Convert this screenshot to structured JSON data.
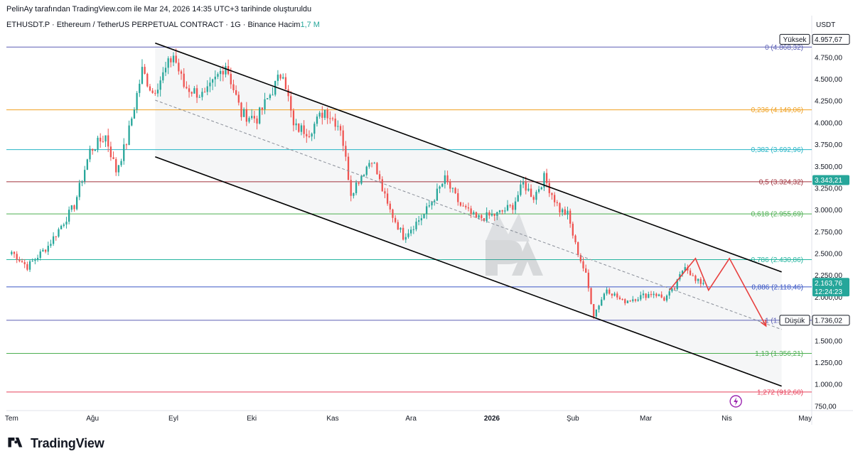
{
  "header": {
    "attribution": "PelinAy tarafından TradingView.com ile Mar 24, 2026 14:35 UTC+3 tarihinde oluşturuldu",
    "symbol": "ETHUSDT.P · Ethereum / TetherUS PERPETUAL CONTRACT · 1G · Binance",
    "volume_label": "Hacim",
    "volume_value": "1,7 M",
    "currency": "USDT"
  },
  "brand": {
    "name": "TradingView",
    "logo_icon": "tradingview-logo-icon"
  },
  "colors": {
    "up": "#26a69a",
    "down": "#ef5350",
    "channel": "#000000",
    "projection": "#e8403f",
    "text": "#131722"
  },
  "chart_data": {
    "type": "candlestick",
    "title": "",
    "ylim": [
      700,
      5050
    ],
    "y_ticks": [
      {
        "value": 4750,
        "label": "4.750,00"
      },
      {
        "value": 4500,
        "label": "4.500,00"
      },
      {
        "value": 4250,
        "label": "4.250,00"
      },
      {
        "value": 4000,
        "label": "4.000,00"
      },
      {
        "value": 3750,
        "label": "3.750,00"
      },
      {
        "value": 3500,
        "label": "3.500,00"
      },
      {
        "value": 3250,
        "label": "3.250,00"
      },
      {
        "value": 3000,
        "label": "3.000,00"
      },
      {
        "value": 2750,
        "label": "2.750,00"
      },
      {
        "value": 2500,
        "label": "2.500,00"
      },
      {
        "value": 2250,
        "label": "2.250,00"
      },
      {
        "value": 2000,
        "label": "2.000,00"
      },
      {
        "value": 1500,
        "label": "1.500,00"
      },
      {
        "value": 1250,
        "label": "1.250,00"
      },
      {
        "value": 1000,
        "label": "1.000,00"
      },
      {
        "value": 750,
        "label": "750,00"
      }
    ],
    "x_ticks": [
      {
        "day": 0,
        "label": "Tem"
      },
      {
        "day": 31,
        "label": "Ağu"
      },
      {
        "day": 62,
        "label": "Eyl"
      },
      {
        "day": 92,
        "label": "Eki"
      },
      {
        "day": 123,
        "label": "Kas"
      },
      {
        "day": 153,
        "label": "Ara"
      },
      {
        "day": 184,
        "label": "2026"
      },
      {
        "day": 215,
        "label": "Şub"
      },
      {
        "day": 243,
        "label": "Mar"
      },
      {
        "day": 274,
        "label": "Nis"
      },
      {
        "day": 304,
        "label": "May"
      }
    ],
    "x_range_days": [
      -2,
      306
    ],
    "fib_levels": [
      {
        "ratio": 0,
        "price": 4868.32,
        "label": "0 (4.868,32)",
        "color": "#5b5fb5"
      },
      {
        "ratio": 0.236,
        "price": 4149.06,
        "label": "0,236 (4.149,06)",
        "color": "#f0a020"
      },
      {
        "ratio": 0.382,
        "price": 3692.96,
        "label": "0,382 (3.692,96)",
        "color": "#26b5c6"
      },
      {
        "ratio": 0.5,
        "price": 3324.32,
        "label": "0,5 (3.324,32)",
        "color": "#a0323c"
      },
      {
        "ratio": 0.618,
        "price": 2955.69,
        "label": "0,618 (2.955,69)",
        "color": "#4caf50"
      },
      {
        "ratio": 0.786,
        "price": 2430.86,
        "label": "0,786 (2.430,86)",
        "color": "#26b5a0"
      },
      {
        "ratio": 0.886,
        "price": 2118.46,
        "label": "0,886 (2.118,46)",
        "color": "#3a56c5"
      },
      {
        "ratio": 1,
        "price": 1736.02,
        "label": "1 (1.736,02)",
        "color": "#5b5fb5"
      },
      {
        "ratio": 1.13,
        "price": 1356.21,
        "label": "1,13 (1.356,21)",
        "color": "#4caf50"
      },
      {
        "ratio": 1.272,
        "price": 912.6,
        "label": "1,272 (912,60)",
        "color": "#e8405a"
      }
    ],
    "price_tags": [
      {
        "price": 4957.67,
        "label": "4.957,67",
        "caption": "Yüksek",
        "style": "outline"
      },
      {
        "price": 3343.21,
        "label": "3.343,21",
        "caption": "",
        "style": "green"
      },
      {
        "price": 2163.76,
        "label": "2.163,76",
        "caption": "12:24:23",
        "style": "green"
      },
      {
        "price": 1736.02,
        "label": "1.736,02",
        "caption": "Düşük",
        "style": "outline"
      }
    ],
    "channel": {
      "upper": [
        [
          55,
          4915
        ],
        [
          295,
          2290
        ]
      ],
      "lower": [
        [
          55,
          3610
        ],
        [
          295,
          980
        ]
      ],
      "middle": [
        [
          55,
          4260
        ],
        [
          295,
          1630
        ]
      ]
    },
    "projection": [
      [
        252,
        2080
      ],
      [
        262,
        2445
      ],
      [
        267,
        2080
      ],
      [
        275,
        2445
      ],
      [
        289,
        1670
      ]
    ],
    "key_points": [
      {
        "day": 0,
        "price": 2520
      },
      {
        "day": 6,
        "price": 2350
      },
      {
        "day": 14,
        "price": 2590
      },
      {
        "day": 24,
        "price": 3050
      },
      {
        "day": 30,
        "price": 3680
      },
      {
        "day": 36,
        "price": 3850
      },
      {
        "day": 40,
        "price": 3450
      },
      {
        "day": 44,
        "price": 3780
      },
      {
        "day": 50,
        "price": 4600
      },
      {
        "day": 54,
        "price": 4350
      },
      {
        "day": 58,
        "price": 4550
      },
      {
        "day": 62,
        "price": 4780
      },
      {
        "day": 66,
        "price": 4420
      },
      {
        "day": 74,
        "price": 4300
      },
      {
        "day": 82,
        "price": 4680
      },
      {
        "day": 88,
        "price": 4100
      },
      {
        "day": 94,
        "price": 4050
      },
      {
        "day": 104,
        "price": 4600
      },
      {
        "day": 108,
        "price": 3950
      },
      {
        "day": 114,
        "price": 3900
      },
      {
        "day": 120,
        "price": 4150
      },
      {
        "day": 126,
        "price": 3950
      },
      {
        "day": 130,
        "price": 3200
      },
      {
        "day": 138,
        "price": 3600
      },
      {
        "day": 144,
        "price": 3050
      },
      {
        "day": 150,
        "price": 2700
      },
      {
        "day": 158,
        "price": 2950
      },
      {
        "day": 166,
        "price": 3350
      },
      {
        "day": 172,
        "price": 3050
      },
      {
        "day": 178,
        "price": 2900
      },
      {
        "day": 186,
        "price": 2950
      },
      {
        "day": 192,
        "price": 3050
      },
      {
        "day": 196,
        "price": 3300
      },
      {
        "day": 200,
        "price": 3150
      },
      {
        "day": 204,
        "price": 3370
      },
      {
        "day": 210,
        "price": 3000
      },
      {
        "day": 213,
        "price": 2950
      },
      {
        "day": 216,
        "price": 2600
      },
      {
        "day": 220,
        "price": 2250
      },
      {
        "day": 223,
        "price": 1800
      },
      {
        "day": 228,
        "price": 2100
      },
      {
        "day": 234,
        "price": 1950
      },
      {
        "day": 240,
        "price": 2000
      },
      {
        "day": 246,
        "price": 2050
      },
      {
        "day": 250,
        "price": 1980
      },
      {
        "day": 254,
        "price": 2100
      },
      {
        "day": 258,
        "price": 2380
      },
      {
        "day": 262,
        "price": 2180
      },
      {
        "day": 265,
        "price": 2163.76
      }
    ]
  }
}
